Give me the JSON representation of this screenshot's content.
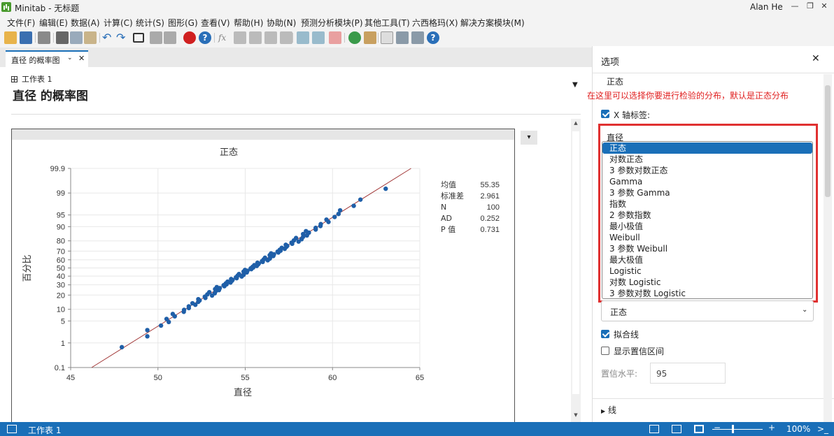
{
  "window": {
    "app_name": "Minitab - 无标题",
    "user": "Alan He"
  },
  "menu": [
    "文件(F)",
    "编辑(E)",
    "数据(A)",
    "计算(C)",
    "统计(S)",
    "图形(G)",
    "查看(V)",
    "帮助(H)",
    "协助(N)",
    "预测分析模块(P)",
    "其他工具(T)",
    "六西格玛(X)",
    "解决方案模块(M)"
  ],
  "tab": {
    "label": "直径 的概率图"
  },
  "doc": {
    "worksheet": "工作表 1",
    "title": "直径 的概率图"
  },
  "chart_data": {
    "type": "scatter",
    "title": "正态",
    "xlabel": "直径",
    "ylabel": "百分比",
    "xlim": [
      45,
      65
    ],
    "x_ticks": [
      "45",
      "50",
      "55",
      "60",
      "65"
    ],
    "y_ticks": [
      "0.1",
      "1",
      "5",
      "10",
      "20",
      "30",
      "40",
      "50",
      "60",
      "70",
      "80",
      "90",
      "95",
      "99",
      "99.9"
    ],
    "y_scale": "normal-probability",
    "fit_line": {
      "mean": 55.35,
      "stdev": 2.961
    },
    "stats_table": [
      {
        "label": "均值",
        "value": "55.35"
      },
      {
        "label": "标准差",
        "value": "2.961"
      },
      {
        "label": "N",
        "value": "100"
      },
      {
        "label": "AD",
        "value": "0.252"
      },
      {
        "label": "P 值",
        "value": "0.731"
      }
    ],
    "point_color": "#1f5fa8",
    "line_color": "#a33a3a"
  },
  "options": {
    "header": "选项",
    "distribution_label_top": "正态",
    "annotation": "在这里可以选择你要进行检验的分布，默认是正态分布",
    "x_axis_label": "X 轴标签:",
    "x_axis_value": "直径",
    "dist_list": [
      "正态",
      "对数正态",
      "3 参数对数正态",
      "Gamma",
      "3 参数 Gamma",
      "指数",
      "2 参数指数",
      "最小极值",
      "Weibull",
      "3 参数 Weibull",
      "最大极值",
      "Logistic",
      "对数 Logistic",
      "3 参数对数 Logistic"
    ],
    "dist_selected": "正态",
    "fit_line": "拟合线",
    "show_ci": "显示置信区间",
    "conf_label": "置信水平:",
    "conf_value": "95",
    "lines_section": "线"
  },
  "status": {
    "worksheet": "工作表 1",
    "zoom": "100%"
  }
}
